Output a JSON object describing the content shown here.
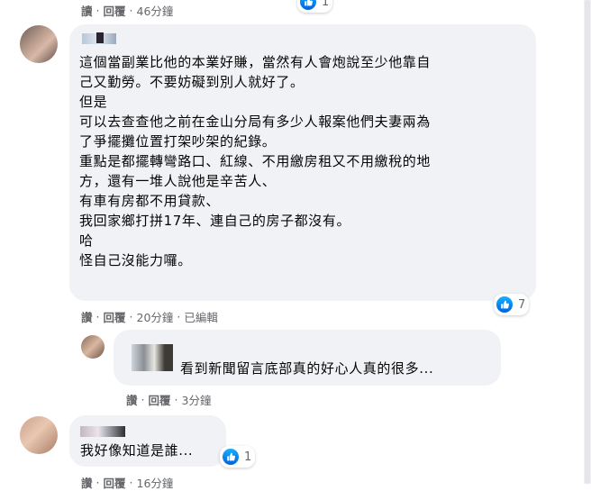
{
  "top_meta": {
    "reply": "讀",
    "reply2": "回覆",
    "time": "46分鐘",
    "reaction_count": "1"
  },
  "comment1": {
    "lines": [
      "這個當副業比他的本業好賺，當然有人會炮說至少他靠自",
      "己又勤勞。不要妨礙到別人就好了。",
      "但是",
      "可以去查查他之前在金山分局有多少人報案他們夫妻兩為",
      "了爭擺攤位置打架吵架的紀錄。",
      "重點是都擺轉彎路口、紅線、不用繳房租又不用繳稅的地",
      "方，還有一堆人說他是辛苦人、",
      "有車有房都不用貸款、",
      "我回家鄉打拼17年、連自己的房子都沒有。",
      "哈",
      "怪自己沒能力囉。"
    ],
    "reaction_count": "7",
    "meta": {
      "like": "讚",
      "reply": "回覆",
      "time": "20分鐘",
      "edited": "已編輯"
    }
  },
  "reply1": {
    "text": "看到新聞留言底部真的好心人真的很多...",
    "meta": {
      "like": "讚",
      "reply": "回覆",
      "time": "3分鐘"
    }
  },
  "comment2": {
    "text": "我好像知道是誰...",
    "reaction_count": "1",
    "meta": {
      "like": "讚",
      "reply": "回覆",
      "time": "16分鐘"
    }
  },
  "colors": {
    "bubble": "#f0f2f5",
    "meta_text": "#65676b",
    "like_blue": "#1877f2"
  },
  "icons": {
    "reaction": "like-thumb-icon"
  }
}
